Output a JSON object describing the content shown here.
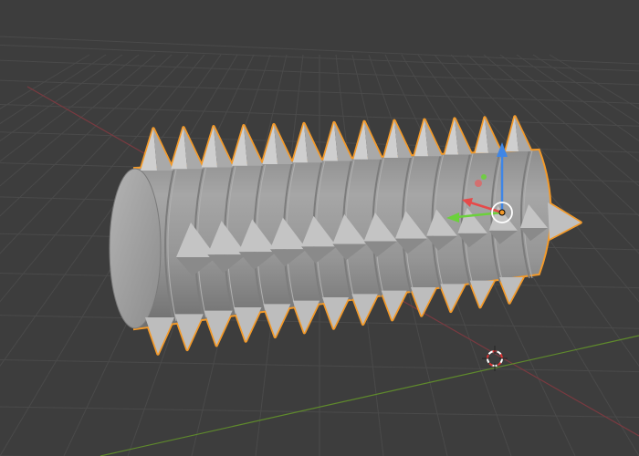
{
  "viewport": {
    "view": "3D Viewport",
    "background_color": "#3d3d3d",
    "grid_color": "#4a4a4a",
    "x_axis_color": "#7a3a40",
    "y_axis_color": "#5f8a2c"
  },
  "object": {
    "name": "spiked-cylinder",
    "selected": true,
    "outline_color": "#f39a2a",
    "surface_color": "#9e9e9e",
    "spike_rows": 13
  },
  "gizmo": {
    "type": "translate",
    "z_color": "#3f86e6",
    "y_color": "#6bd13b",
    "x_color": "#e64a4a"
  },
  "cursor_3d": {
    "icon": "crosshair-3d-cursor-icon"
  }
}
